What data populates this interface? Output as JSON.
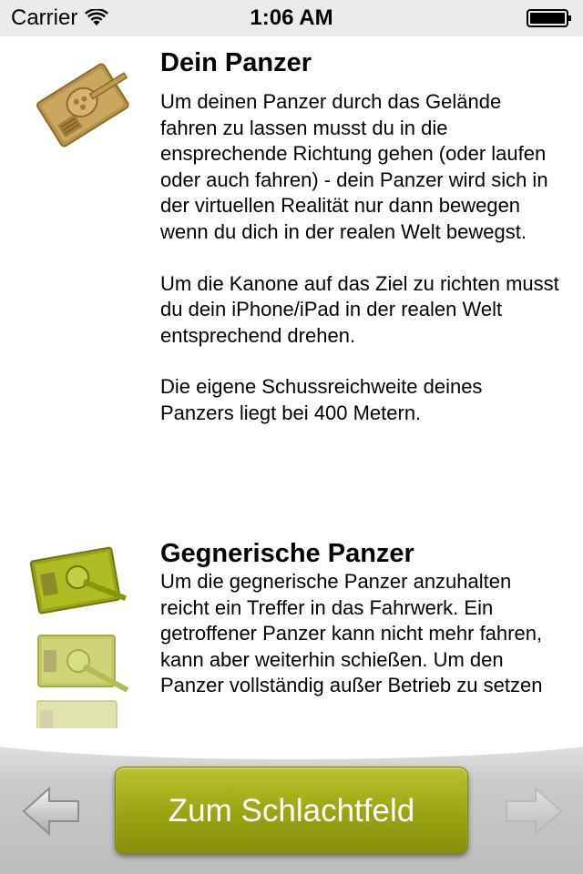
{
  "status_bar": {
    "carrier": "Carrier",
    "time": "1:06 AM"
  },
  "sections": [
    {
      "title": "Dein Panzer",
      "paragraphs": [
        "Um deinen Panzer durch das Gelände fahren zu lassen musst du in die ensprechende Richtung gehen (oder laufen oder auch fahren) - dein Panzer wird sich in der virtuellen Realität nur dann bewegen wenn du dich in der realen Welt bewegst.",
        "Um die Kanone auf das Ziel zu richten musst du dein iPhone/iPad in der realen Welt entsprechend drehen.",
        "Die eigene Schussreichweite deines Panzers liegt bei 400 Metern."
      ]
    },
    {
      "title": "Gegnerische Panzer",
      "paragraphs": [
        "Um die gegnerische Panzer anzuhalten reicht ein Treffer in das Fahrwerk. Ein getroffener Panzer kann nicht mehr fahren, kann aber weiterhin schießen. Um den Panzer vollständig außer Betrieb zu setzen"
      ]
    }
  ],
  "bottom_bar": {
    "main_button_label": "Zum Schlachtfeld"
  },
  "colors": {
    "button": "#9aa413",
    "own_tank": "#c4a055",
    "enemy_tank": "#a8b51c"
  }
}
